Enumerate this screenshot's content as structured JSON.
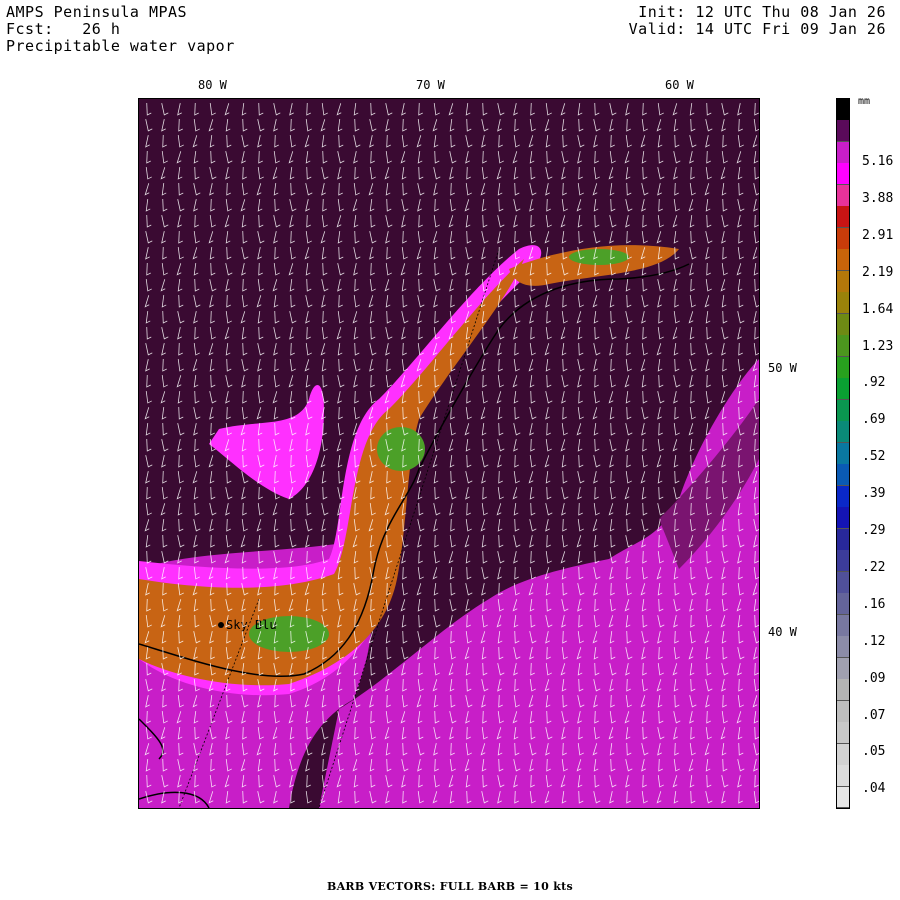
{
  "header": {
    "model": "AMPS Peninsula MPAS",
    "forecast": "Fcst:   26 h",
    "variable": "Precipitable water vapor",
    "init": "Init: 12 UTC Thu 08 Jan 26",
    "valid": "Valid: 14 UTC Fri 09 Jan 26"
  },
  "map": {
    "lon_labels": [
      "80 W",
      "70 W",
      "60 W"
    ],
    "lat_labels": [
      "50 W",
      "40 W"
    ],
    "station": "Sky Blu",
    "field_colors": {
      "background": "#3a0a32",
      "magenta": "#c81ec8",
      "pink": "#ff30ff",
      "orange": "#c86414",
      "green": "#4ca028",
      "coast": "#000000",
      "barb": "#ffffff"
    }
  },
  "colorbar": {
    "unit": "mm",
    "labels": [
      "5.16",
      "3.88",
      "2.91",
      "2.19",
      "1.64",
      "1.23",
      ".92",
      ".69",
      ".52",
      ".39",
      ".29",
      ".22",
      ".16",
      ".12",
      ".09",
      ".07",
      ".05",
      ".04"
    ],
    "colors": [
      "#000000",
      "#5a0a5a",
      "#c81ec8",
      "#ff00ff",
      "#e8329a",
      "#c81414",
      "#c83c0a",
      "#c8640a",
      "#b4780a",
      "#9a820a",
      "#6e8a14",
      "#4c961e",
      "#28a01e",
      "#0aa032",
      "#0a9650",
      "#0a8a78",
      "#0a78a0",
      "#0a5ab4",
      "#0a28c8",
      "#1414b4",
      "#28289a",
      "#3c3c9a",
      "#50509a",
      "#64649a",
      "#7878a0",
      "#8c8ca8",
      "#a0a0b0",
      "#b4b4b4",
      "#bebebe",
      "#c8c8c8",
      "#d2d2d2",
      "#dcdcdc",
      "#e6e6e6"
    ]
  },
  "footer": "BARB VECTORS:  FULL BARB = 10 kts"
}
